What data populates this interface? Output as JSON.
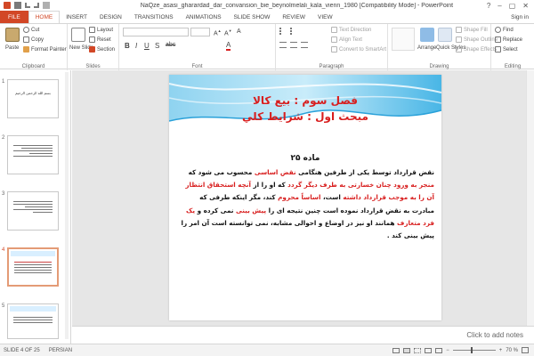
{
  "titlebar": {
    "title": "NaQze_asasi_gharardad_dar_convansion_bie_beynolmelali_kala_vienn_1980 [Compatibility Mode] - PowerPoint",
    "help": "?",
    "minimize": "–",
    "restore": "▢",
    "close": "✕"
  },
  "tabs": [
    {
      "label": "FILE"
    },
    {
      "label": "HOME"
    },
    {
      "label": "INSERT"
    },
    {
      "label": "DESIGN"
    },
    {
      "label": "TRANSITIONS"
    },
    {
      "label": "ANIMATIONS"
    },
    {
      "label": "SLIDE SHOW"
    },
    {
      "label": "REVIEW"
    },
    {
      "label": "VIEW"
    }
  ],
  "user": "Sign in",
  "ribbon": {
    "clipboard": {
      "label": "Clipboard",
      "paste": "Paste",
      "cut": "Cut",
      "copy": "Copy",
      "format_painter": "Format Painter"
    },
    "slides": {
      "label": "Slides",
      "new_slide": "New Slide",
      "layout": "Layout",
      "reset": "Reset",
      "section": "Section"
    },
    "font": {
      "label": "Font"
    },
    "paragraph": {
      "label": "Paragraph",
      "text_direction": "Text Direction",
      "align_text": "Align Text",
      "convert_smartart": "Convert to SmartArt"
    },
    "drawing": {
      "label": "Drawing",
      "arrange": "Arrange",
      "quick_styles": "Quick Styles",
      "shape_fill": "Shape Fill",
      "shape_outline": "Shape Outline",
      "shape_effects": "Shape Effects"
    },
    "editing": {
      "label": "Editing",
      "find": "Find",
      "replace": "Replace",
      "select": "Select"
    }
  },
  "thumbnails": [
    {
      "num": "1",
      "text": "بسم الله الرحمن الرحيم"
    },
    {
      "num": "2"
    },
    {
      "num": "3"
    },
    {
      "num": "4"
    },
    {
      "num": "5"
    }
  ],
  "slide": {
    "heading1": "فصل سوم :  بيع كالا",
    "heading2": "مبحث اول : شرايط كلي",
    "article": "ماده ۲۵",
    "body": [
      {
        "text": "نقض قرارداد توسط يكی از طرفين هنگامی ",
        "red": false
      },
      {
        "text": "نقض اساسی",
        "red": true
      },
      {
        "text": " محسوب می شود كه ",
        "red": false
      },
      {
        "text": "منجر به ورود چنان خسارتی به طرف ديگر گردد",
        "red": true
      },
      {
        "text": " كه او را از ",
        "red": false
      },
      {
        "text": "آنچه استحقاق انتظار آن را به موجب قرارداد داشته",
        "red": true
      },
      {
        "text": " است، ",
        "red": false
      },
      {
        "text": "اساساً محروم",
        "red": true
      },
      {
        "text": " كند، مگر اينكه طرفی كه مبادرت به نقض قرارداد نموده است چنين نتيجه ای را ",
        "red": false
      },
      {
        "text": "پيش بينی",
        "red": true
      },
      {
        "text": " نمی كرده و ",
        "red": false
      },
      {
        "text": "يک فرد متعارف",
        "red": true
      },
      {
        "text": " همانند او نيز در اوضاع و احوالی مشابه، نمی توانسته است آن امر را پيش بينی كند .",
        "red": false
      }
    ]
  },
  "notes_placeholder": "Click to add notes",
  "status": {
    "slide": "SLIDE 4 OF 25",
    "language": "PERSIAN",
    "zoom": "70 %",
    "zoom_level": 0.42
  },
  "colors": {
    "accent": "#d24726",
    "title_red": "#d81e1e",
    "header_blue": "#2aa1d9"
  }
}
